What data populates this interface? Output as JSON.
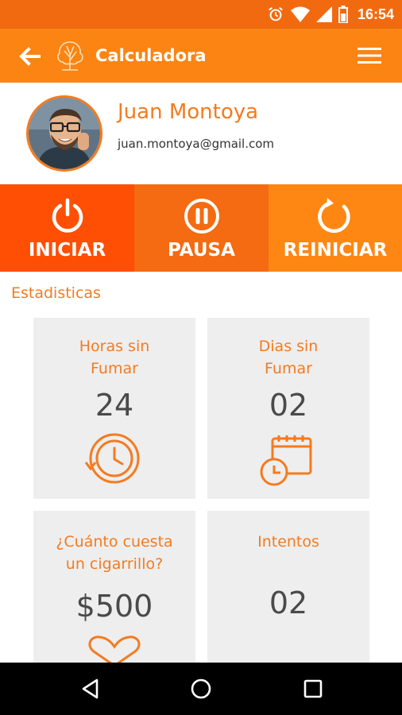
{
  "status_bar": {
    "time": "16:54",
    "icons": [
      "alarm-icon",
      "wifi-icon",
      "signal-icon",
      "battery-icon"
    ]
  },
  "app_bar": {
    "title": "Calculadora",
    "back_icon": "arrow-left-icon",
    "logo_icon": "tree-logo-icon",
    "menu_icon": "hamburger-menu-icon"
  },
  "profile": {
    "name": "Juan Montoya",
    "email": "juan.montoya@gmail.com"
  },
  "actions": [
    {
      "label": "INICIAR",
      "icon": "power-icon",
      "color": "#ff4f05"
    },
    {
      "label": "PAUSA",
      "icon": "pause-circle-icon",
      "color": "#f46b12"
    },
    {
      "label": "REINICIAR",
      "icon": "refresh-icon",
      "color": "#fe8713"
    }
  ],
  "stats": {
    "section_title": "Estadisticas",
    "cards": [
      {
        "title_line1": "Horas sin",
        "title_line2": "Fumar",
        "value": "24",
        "icon": "clock-history-icon"
      },
      {
        "title_line1": "Dias sin",
        "title_line2": "Fumar",
        "value": "02",
        "icon": "calendar-clock-icon"
      },
      {
        "title_line1": "¿Cuánto cuesta",
        "title_line2": "un cigarrillo?",
        "value": "$500",
        "icon": "heart-icon"
      },
      {
        "title_line1": "Intentos",
        "title_line2": "",
        "value": "02",
        "icon": ""
      }
    ]
  },
  "colors": {
    "accent": "#f47b20",
    "status_bar": "#f26a10",
    "app_bar": "#fb8413",
    "card_bg": "#eeeeee",
    "value_text": "#4a4a4a"
  },
  "nav_bar": {
    "icons": [
      "nav-back-icon",
      "nav-home-icon",
      "nav-recents-icon"
    ]
  }
}
